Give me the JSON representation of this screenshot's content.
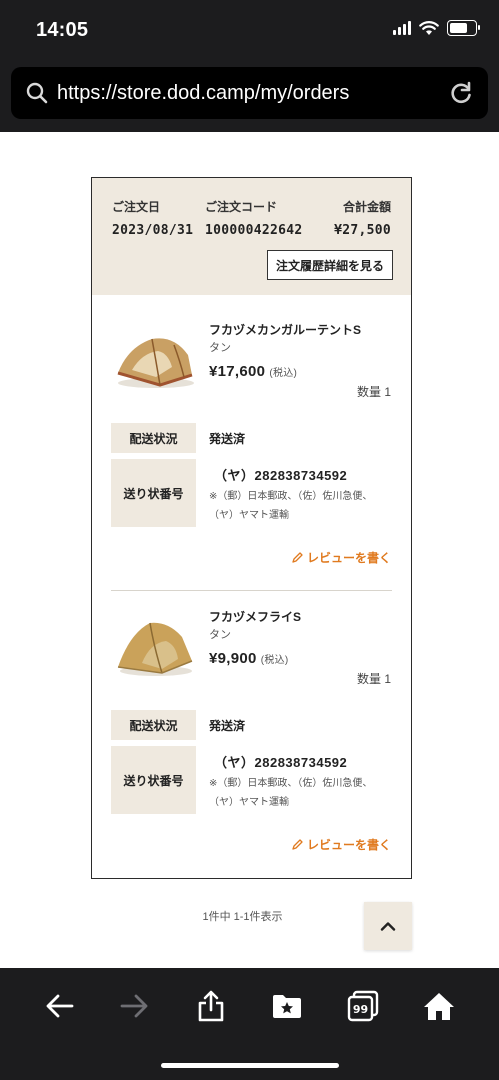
{
  "status_bar": {
    "time": "14:05"
  },
  "browser": {
    "url": "https://store.dod.camp/my/orders"
  },
  "order": {
    "date_label": "ご注文日",
    "date": "2023/08/31",
    "code_label": "ご注文コード",
    "code": "100000422642",
    "total_label": "合計金額",
    "total": "¥27,500",
    "detail_button": "注文履歴詳細を見る"
  },
  "items": [
    {
      "name": "フカヅメカンガルーテントS",
      "color": "タン",
      "price": "¥17,600",
      "tax": "(税込)",
      "qty": "数量 1",
      "status_label": "配送状況",
      "status": "発送済",
      "tracking_label": "送り状番号",
      "tracking": "（ヤ）282838734592",
      "tracking_note": "※（郵）日本郵政、（佐）佐川急便、（ヤ）ヤマト運輸",
      "review": "レビューを書く"
    },
    {
      "name": "フカヅメフライS",
      "color": "タン",
      "price": "¥9,900",
      "tax": "(税込)",
      "qty": "数量 1",
      "status_label": "配送状況",
      "status": "発送済",
      "tracking_label": "送り状番号",
      "tracking": "（ヤ）282838734592",
      "tracking_note": "※（郵）日本郵政、（佐）佐川急便、（ヤ）ヤマト運輸",
      "review": "レビューを書く"
    }
  ],
  "pagination": {
    "text": "1件中 1-1件表示"
  },
  "colors": {
    "accent": "#e07a1f",
    "beige": "#efe9df",
    "chrome": "#1c1c1e"
  },
  "icons": [
    "search-icon",
    "reload-icon",
    "back-icon",
    "forward-icon",
    "share-icon",
    "bookmarks-icon",
    "tabs-icon",
    "home-icon",
    "pencil-icon",
    "chevron-up-icon"
  ]
}
